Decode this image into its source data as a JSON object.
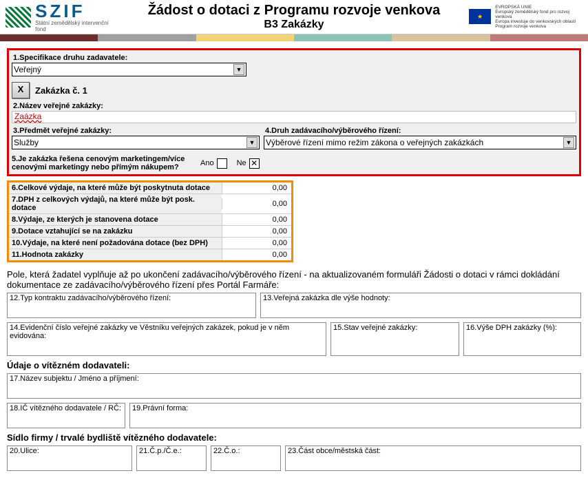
{
  "header": {
    "logo_text": "SZIF",
    "logo_subtext": "Státní zemědělský intervenční fond",
    "title1": "Žádost o dotaci z Programu rozvoje venkova",
    "title2": "B3 Zakázky",
    "eu_line1": "EVROPSKÁ UNIE",
    "eu_line2": "Evropský zemědělský fond pro rozvoj venkova",
    "eu_line3": "Evropa investuje do venkovských oblastí",
    "eu_line4": "Program rozvoje venkova"
  },
  "red": {
    "lbl1": "1.Specifikace druhu zadavatele:",
    "val1": "Veřejný",
    "btn_x": "X",
    "order_title": "Zakázka č. 1",
    "lbl2": "2.Název veřejné zakázky:",
    "val2": "Zaázka",
    "lbl3": "3.Předmět veřejné zakázky:",
    "val3": "Služby",
    "lbl4": "4.Druh zadávacího/výběrového řízení:",
    "val4": "Výběrové řízení mimo režim zákona o veřejných zakázkách",
    "lbl5": "5.Je zakázka řešena cenovým marketingem/více cenovými marketingy nebo přímým nákupem?",
    "ano": "Ano",
    "ne": "Ne",
    "ne_mark": "✕"
  },
  "orange": {
    "r6": {
      "lbl": "6.Celkové výdaje, na které může být poskytnuta dotace",
      "val": "0,00"
    },
    "r7": {
      "lbl": "7.DPH z celkových výdajů, na které může být posk. dotace",
      "val": "0,00"
    },
    "r8": {
      "lbl": "8.Výdaje, ze kterých je stanovena dotace",
      "val": "0,00"
    },
    "r9": {
      "lbl": "9.Dotace vztahující se na zakázku",
      "val": "0,00"
    },
    "r10": {
      "lbl": "10.Výdaje, na které není požadována dotace (bez DPH)",
      "val": "0,00"
    },
    "r11": {
      "lbl": "11.Hodnota zakázky",
      "val": "0,00"
    }
  },
  "note": "Pole, která žadatel vyplňuje až po ukončení zadávacího/výběrového řízení - na aktualizovaném formuláři Žádosti o dotaci v rámci dokládání dokumentace ze zadávacího/výběrového řízení přes Portál Farmáře:",
  "f12": "12.Typ kontraktu zadávacího/výběrového řízení:",
  "f13": "13.Veřejná zakázka dle výše hodnoty:",
  "f14": "14.Evidenční číslo veřejné zakázky ve Věstníku veřejných zakázek, pokud je v něm evidována:",
  "f15": "15.Stav veřejné zakázky:",
  "f16": "16.Výše DPH zakázky (%):",
  "sub1": "Údaje o vítězném dodavateli:",
  "f17": "17.Název subjektu / Jméno a příjmení:",
  "f18": "18.IČ vítězného dodavatele / RČ:",
  "f19": "19.Právní forma:",
  "sub2": "Sídlo firmy / trvalé bydliště vítězného dodavatele:",
  "f20": "20.Ulice:",
  "f21": "21.Č.p./Č.e.:",
  "f22": "22.Č.o.:",
  "f23": "23.Část obce/městská část:"
}
